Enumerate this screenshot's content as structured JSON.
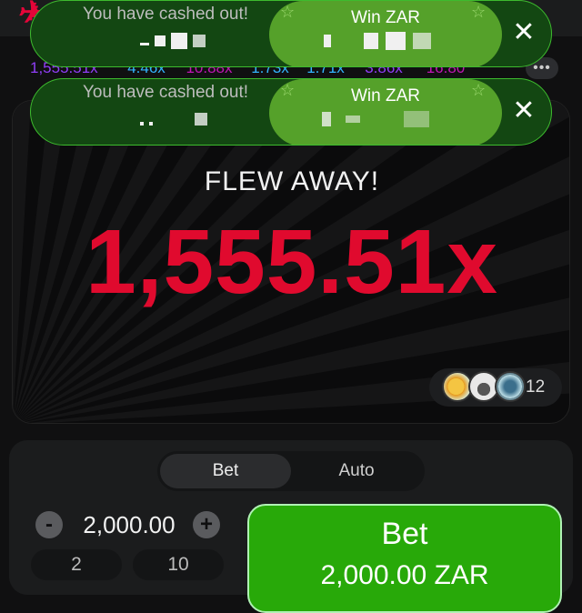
{
  "history": {
    "multipliers": [
      {
        "value": "1,555.51x",
        "color": "#913ef8"
      },
      {
        "value": "4.46x",
        "color": "#34b4ff"
      },
      {
        "value": "10.88x",
        "color": "#c017b4"
      },
      {
        "value": "1.73x",
        "color": "#34b4ff"
      },
      {
        "value": "1.71x",
        "color": "#34b4ff"
      },
      {
        "value": "3.86x",
        "color": "#913ef8"
      },
      {
        "value": "16.80",
        "color": "#c017b4"
      }
    ],
    "more_icon": "ellipsis-icon"
  },
  "toasts": [
    {
      "label": "You have cashed out!",
      "win_label": "Win ZAR",
      "close_icon": "close-icon"
    },
    {
      "label": "You have cashed out!",
      "win_label": "Win ZAR",
      "close_icon": "close-icon"
    }
  ],
  "game": {
    "status": "FLEW AWAY!",
    "crash_multiplier": "1,555.51x",
    "players_count": "12"
  },
  "bet_panel": {
    "tabs": [
      {
        "label": "Bet",
        "active": true
      },
      {
        "label": "Auto",
        "active": false
      }
    ],
    "amount": "2,000.00",
    "minus_label": "-",
    "plus_label": "+",
    "quick_amounts": [
      "2",
      "10"
    ],
    "bet_button": {
      "line1": "Bet",
      "line2": "2,000.00 ZAR"
    }
  },
  "colors": {
    "accent_red": "#e00a2e",
    "win_green": "#55a12a",
    "bet_green": "#28a909"
  }
}
